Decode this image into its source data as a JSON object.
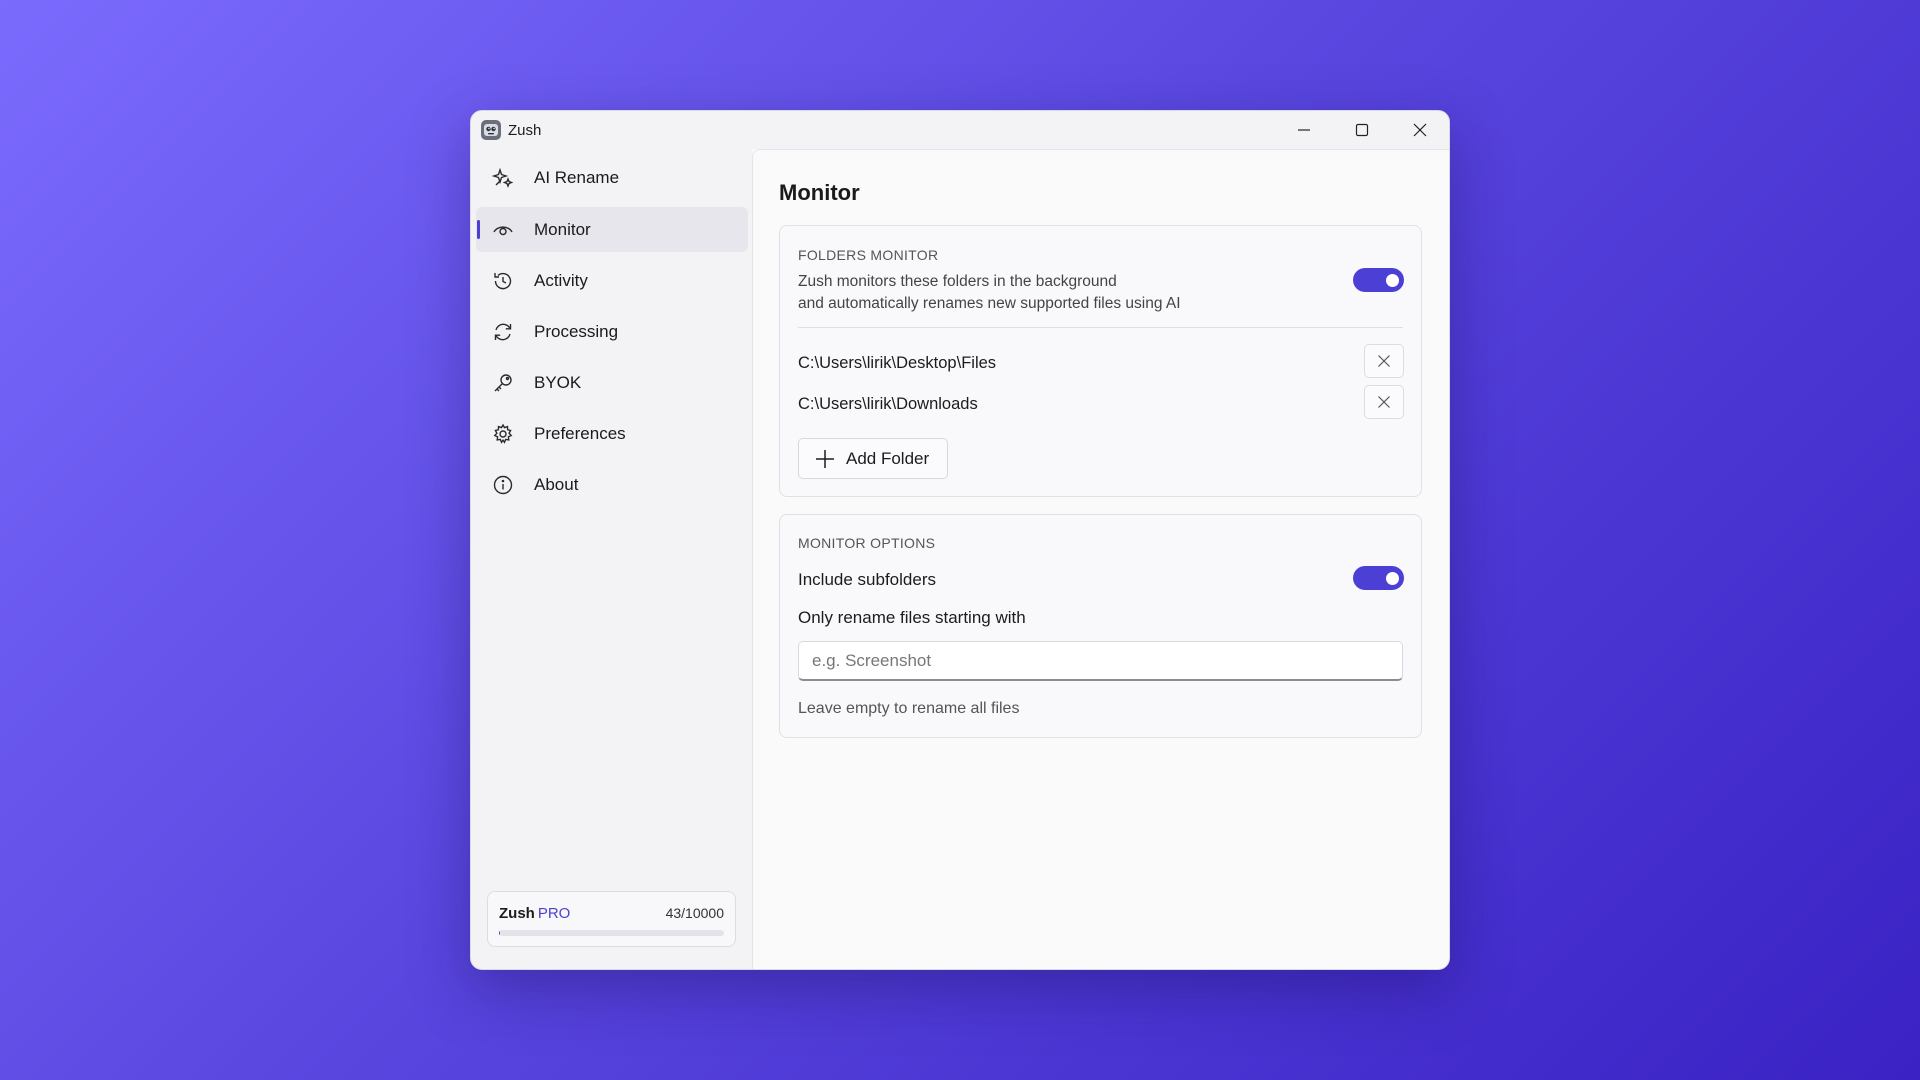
{
  "window": {
    "title": "Zush",
    "controls": [
      "minimize-icon",
      "maximize-icon",
      "close-icon"
    ]
  },
  "sidebar": {
    "items": [
      {
        "label": "AI Rename",
        "icon": "sparkle-icon",
        "active": false
      },
      {
        "label": "Monitor",
        "icon": "eye-icon",
        "active": true
      },
      {
        "label": "Activity",
        "icon": "history-icon",
        "active": false
      },
      {
        "label": "Processing",
        "icon": "sync-icon",
        "active": false
      },
      {
        "label": "BYOK",
        "icon": "key-icon",
        "active": false
      },
      {
        "label": "Preferences",
        "icon": "gear-icon",
        "active": false
      },
      {
        "label": "About",
        "icon": "info-icon",
        "active": false
      }
    ],
    "pro": {
      "name": "Zush",
      "badge": "PRO",
      "usage_text": "43/10000",
      "usage_fraction": 0.0043
    }
  },
  "main": {
    "title": "Monitor",
    "folders_card": {
      "title": "FOLDERS MONITOR",
      "desc_line1": "Zush monitors these folders in the background",
      "desc_line2": "and automatically renames new supported files using AI",
      "enabled": true,
      "folders": [
        "C:\\Users\\lirik\\Desktop\\Files",
        "C:\\Users\\lirik\\Downloads"
      ],
      "add_label": "Add Folder"
    },
    "options_card": {
      "title": "MONITOR OPTIONS",
      "subfolders_label": "Include subfolders",
      "subfolders_enabled": true,
      "prefix_label": "Only rename files starting with",
      "prefix_placeholder": "e.g. Screenshot",
      "prefix_value": "",
      "hint": "Leave empty to rename all files"
    }
  },
  "colors": {
    "accent": "#4b3fd6",
    "background_start": "#7b6bfd",
    "background_end": "#3a22c4"
  }
}
